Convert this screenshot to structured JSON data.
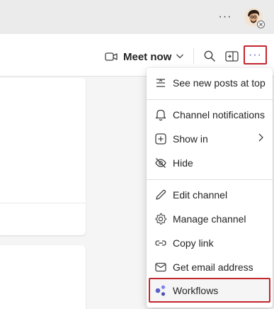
{
  "titlebar": {
    "more_label": "···"
  },
  "header": {
    "meet_label": "Meet now",
    "more_label": "···"
  },
  "menu": {
    "items": [
      {
        "label": "See new posts at top",
        "icon": "arrange-top-icon"
      },
      {
        "label": "Channel notifications",
        "icon": "bell-icon"
      },
      {
        "label": "Show in",
        "icon": "add-square-icon",
        "submenu": true
      },
      {
        "label": "Hide",
        "icon": "eye-off-icon"
      },
      {
        "label": "Edit channel",
        "icon": "pencil-icon"
      },
      {
        "label": "Manage channel",
        "icon": "gear-icon"
      },
      {
        "label": "Copy link",
        "icon": "link-icon"
      },
      {
        "label": "Get email address",
        "icon": "mail-icon"
      },
      {
        "label": "Workflows",
        "icon": "workflows-icon"
      }
    ]
  },
  "colors": {
    "accent": "#5b5fc7",
    "highlight": "#c4262e"
  }
}
